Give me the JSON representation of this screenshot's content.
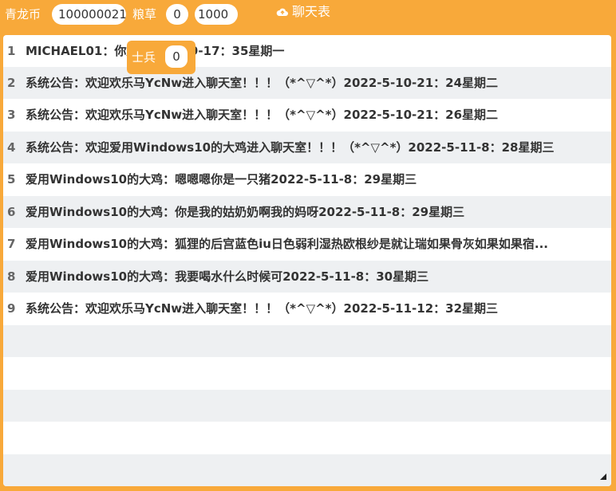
{
  "topbar": {
    "coin_label": "青龙币",
    "coin_value": "100000021",
    "grain_label": "粮草",
    "grain_value": "0",
    "grain_max": "1000",
    "chat_title": "聊天表"
  },
  "popup": {
    "soldier_label": "士兵",
    "soldier_value": "0"
  },
  "messages": [
    {
      "index": "1",
      "text": "MICHAEL01：你好2022-5-9-17：35星期一"
    },
    {
      "index": "2",
      "text": "系统公告：欢迎欢乐马YcNw进入聊天室！！！（*^▽^*）2022-5-10-21：24星期二"
    },
    {
      "index": "3",
      "text": "系统公告：欢迎欢乐马YcNw进入聊天室！！！（*^▽^*）2022-5-10-21：26星期二"
    },
    {
      "index": "4",
      "text": "系统公告：欢迎爱用Windows10的大鸡进入聊天室！！！（*^▽^*）2022-5-11-8：28星期三"
    },
    {
      "index": "5",
      "text": "爱用Windows10的大鸡：嗯嗯嗯你是一只猪2022-5-11-8：29星期三"
    },
    {
      "index": "6",
      "text": "爱用Windows10的大鸡：你是我的姑奶奶啊我的妈呀2022-5-11-8：29星期三"
    },
    {
      "index": "7",
      "text": "爱用Windows10的大鸡：狐狸的后宫蓝色iu日色弱利湿热欧根纱是就让瑞如果骨灰如果如果宿..."
    },
    {
      "index": "8",
      "text": "爱用Windows10的大鸡：我要喝水什么时候可2022-5-11-8：30星期三"
    },
    {
      "index": "9",
      "text": "系统公告：欢迎欢乐马YcNw进入聊天室！！！（*^▽^*）2022-5-11-12：32星期三"
    }
  ],
  "icons": {
    "chat": "cloud-icon",
    "resize": "resize-handle-icon"
  },
  "colors": {
    "accent": "#f8a93a",
    "row_alt": "#eef0f2",
    "text": "#333333"
  }
}
